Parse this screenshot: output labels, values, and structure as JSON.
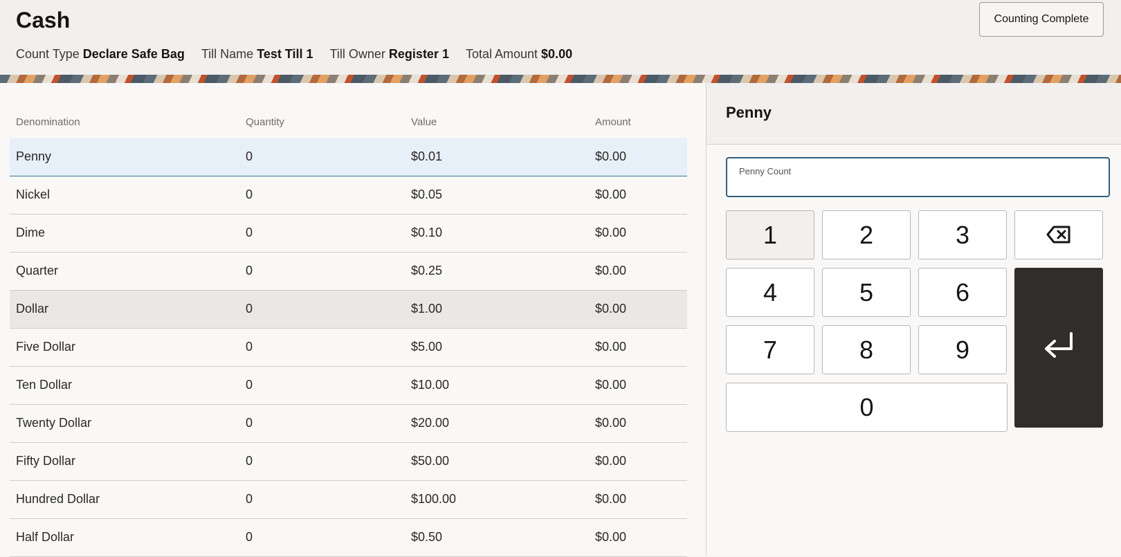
{
  "header": {
    "title": "Cash",
    "complete_label": "Counting Complete",
    "info": [
      {
        "label": "Count Type",
        "value": "Declare Safe Bag"
      },
      {
        "label": "Till Name",
        "value": "Test Till 1"
      },
      {
        "label": "Till Owner",
        "value": "Register 1"
      },
      {
        "label": "Total Amount",
        "value": "$0.00"
      }
    ]
  },
  "table": {
    "headers": {
      "denomination": "Denomination",
      "quantity": "Quantity",
      "value": "Value",
      "amount": "Amount"
    },
    "rows": [
      {
        "denomination": "Penny",
        "quantity": "0",
        "value": "$0.01",
        "amount": "$0.00"
      },
      {
        "denomination": "Nickel",
        "quantity": "0",
        "value": "$0.05",
        "amount": "$0.00"
      },
      {
        "denomination": "Dime",
        "quantity": "0",
        "value": "$0.10",
        "amount": "$0.00"
      },
      {
        "denomination": "Quarter",
        "quantity": "0",
        "value": "$0.25",
        "amount": "$0.00"
      },
      {
        "denomination": "Dollar",
        "quantity": "0",
        "value": "$1.00",
        "amount": "$0.00"
      },
      {
        "denomination": "Five Dollar",
        "quantity": "0",
        "value": "$5.00",
        "amount": "$0.00"
      },
      {
        "denomination": "Ten Dollar",
        "quantity": "0",
        "value": "$10.00",
        "amount": "$0.00"
      },
      {
        "denomination": "Twenty Dollar",
        "quantity": "0",
        "value": "$20.00",
        "amount": "$0.00"
      },
      {
        "denomination": "Fifty Dollar",
        "quantity": "0",
        "value": "$50.00",
        "amount": "$0.00"
      },
      {
        "denomination": "Hundred Dollar",
        "quantity": "0",
        "value": "$100.00",
        "amount": "$0.00"
      },
      {
        "denomination": "Half Dollar",
        "quantity": "0",
        "value": "$0.50",
        "amount": "$0.00"
      }
    ]
  },
  "panel": {
    "title": "Penny",
    "count_label": "Penny Count",
    "count_value": "",
    "keys": {
      "k1": "1",
      "k2": "2",
      "k3": "3",
      "k4": "4",
      "k5": "5",
      "k6": "6",
      "k7": "7",
      "k8": "8",
      "k9": "9",
      "k0": "0"
    },
    "icons": {
      "backspace": "backspace-icon",
      "enter": "enter-icon"
    }
  },
  "colors": {
    "selected_row": "#e7eff8",
    "enter_key": "#312d2a",
    "field_border": "#2f5e7c"
  }
}
